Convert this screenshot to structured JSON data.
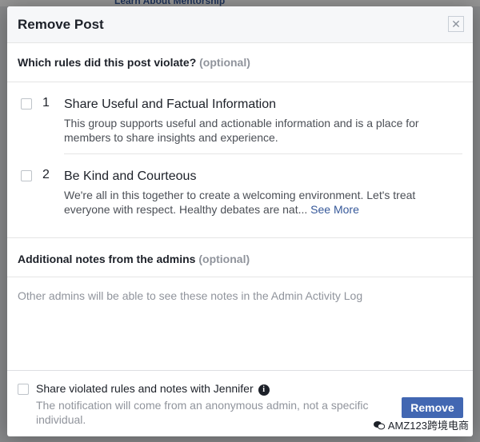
{
  "background": {
    "top_link": "Learn About Mentorship"
  },
  "modal": {
    "title": "Remove Post",
    "close_glyph": "✕",
    "question": "Which rules did this post violate?",
    "optional_label": "(optional)",
    "rules": [
      {
        "number": "1",
        "title": "Share Useful and Factual Information",
        "description": "This group supports useful and actionable information and is a place for members to share insights and experience.",
        "checked": false
      },
      {
        "number": "2",
        "title": "Be Kind and Courteous",
        "description": "We're all in this together to create a welcoming environment. Let's treat everyone with respect. Healthy debates are nat...",
        "see_more": "See More",
        "checked": false
      }
    ],
    "notes_label": "Additional notes from the admins",
    "notes_optional": "(optional)",
    "notes_placeholder": "Other admins will be able to see these notes in the Admin Activity Log",
    "share_label": "Share violated rules and notes with Jennifer",
    "share_info_glyph": "i",
    "share_sub": "The notification will come from an anonymous admin, not a specific individual.",
    "remove_button": "Remove"
  },
  "watermark": {
    "text": "AMZ123跨境电商",
    "icon": "wechat-icon"
  },
  "colors": {
    "primary_button": "#4267b2",
    "link": "#365899",
    "muted": "#90949c",
    "text": "#1d2129"
  }
}
